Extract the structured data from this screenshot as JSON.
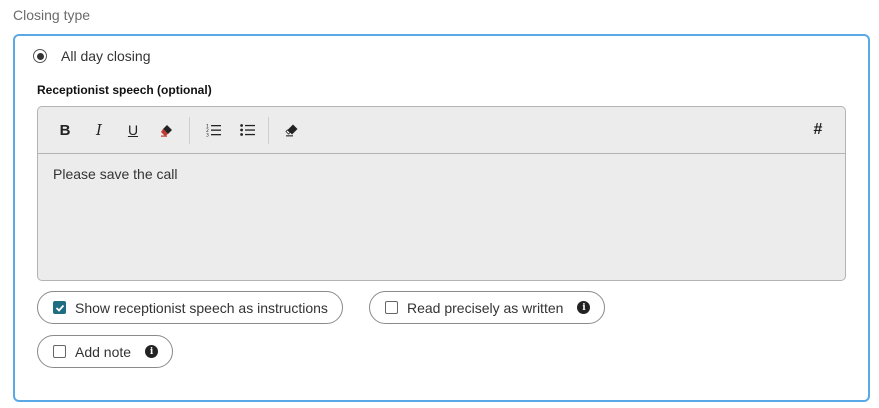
{
  "section": {
    "label": "Closing type"
  },
  "closing_option": {
    "label": "All day closing",
    "selected": true
  },
  "speech": {
    "label": "Receptionist speech (optional)",
    "content": "Please save the call"
  },
  "toolbar": {
    "icons": [
      "bold-icon",
      "italic-icon",
      "underline-icon",
      "highlight-icon",
      "ordered-list-icon",
      "bullet-list-icon",
      "clear-format-icon",
      "hash-icon"
    ],
    "bold_glyph": "B",
    "italic_glyph": "I",
    "underline_glyph": "U",
    "hash_glyph": "#"
  },
  "options": {
    "show_instructions": {
      "label": "Show receptionist speech as instructions",
      "checked": true
    },
    "read_precisely": {
      "label": "Read precisely as written",
      "checked": false
    },
    "add_note": {
      "label": "Add note",
      "checked": false
    }
  },
  "colors": {
    "accent": "#5aa9e6",
    "checkbox_checked": "#1f6d80",
    "highlight": "#c0392b"
  }
}
